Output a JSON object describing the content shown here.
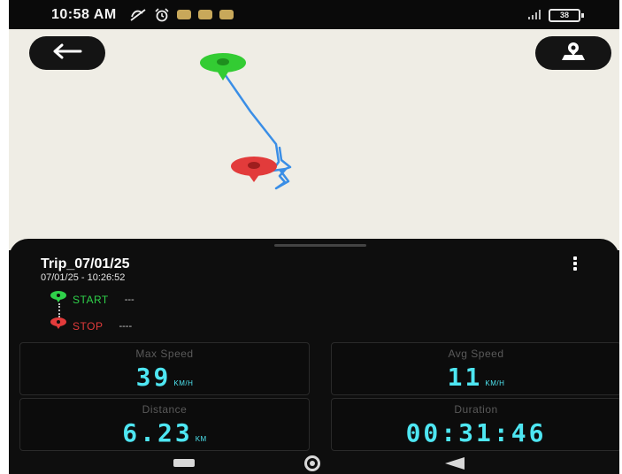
{
  "status_bar": {
    "time": "10:58 AM",
    "battery": "38"
  },
  "map": {
    "back_icon": "arrow-left-icon",
    "location_icon": "location-pin-icon"
  },
  "trip": {
    "title": "Trip_07/01/25",
    "datetime": "07/01/25 - 10:26:52",
    "start_label": "START",
    "start_value": "---",
    "stop_label": "STOP",
    "stop_value": "----"
  },
  "stats": {
    "max_speed": {
      "label": "Max Speed",
      "value": "39",
      "unit": "KM/H"
    },
    "avg_speed": {
      "label": "Avg Speed",
      "value": "11",
      "unit": "KM/H"
    },
    "distance": {
      "label": "Distance",
      "value": "6.23",
      "unit": "KM"
    },
    "duration": {
      "label": "Duration",
      "value": "00:31:46",
      "unit": ""
    }
  },
  "colors": {
    "accent_cyan": "#4ee6f2",
    "start_green": "#2fd14a",
    "stop_red": "#e23b3b",
    "route_blue": "#3a8ee6"
  }
}
